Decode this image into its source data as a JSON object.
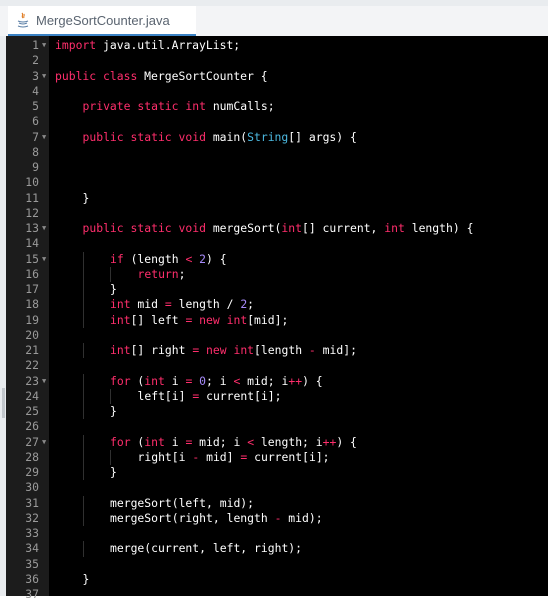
{
  "tab": {
    "filename": "MergeSortCounter.java",
    "icon": "java-file-icon"
  },
  "colors": {
    "keyword": "#ff2e6c",
    "type": "#4cb9e0",
    "number": "#a78bfa",
    "plain": "#ffffff",
    "line_number": "#9a9a9a",
    "editor_bg": "#000000",
    "tab_accent": "#3b82c4"
  },
  "lines": [
    {
      "n": "1",
      "fold": true,
      "indent": 0,
      "tokens": [
        [
          "kw",
          "import"
        ],
        [
          "p",
          " java.util.ArrayList;"
        ]
      ]
    },
    {
      "n": "2",
      "fold": false,
      "indent": 0,
      "tokens": []
    },
    {
      "n": "3",
      "fold": true,
      "indent": 0,
      "tokens": [
        [
          "kw",
          "public"
        ],
        [
          "p",
          " "
        ],
        [
          "kw",
          "class"
        ],
        [
          "p",
          " MergeSortCounter {"
        ]
      ]
    },
    {
      "n": "4",
      "fold": false,
      "indent": 0,
      "tokens": []
    },
    {
      "n": "5",
      "fold": false,
      "indent": 1,
      "tokens": [
        [
          "kw",
          "private"
        ],
        [
          "p",
          " "
        ],
        [
          "kw",
          "static"
        ],
        [
          "p",
          " "
        ],
        [
          "kw",
          "int"
        ],
        [
          "p",
          " numCalls;"
        ]
      ]
    },
    {
      "n": "6",
      "fold": false,
      "indent": 0,
      "tokens": []
    },
    {
      "n": "7",
      "fold": true,
      "indent": 1,
      "tokens": [
        [
          "kw",
          "public"
        ],
        [
          "p",
          " "
        ],
        [
          "kw",
          "static"
        ],
        [
          "p",
          " "
        ],
        [
          "kw",
          "void"
        ],
        [
          "p",
          " main("
        ],
        [
          "ty",
          "String"
        ],
        [
          "p",
          "[] args) {"
        ]
      ]
    },
    {
      "n": "8",
      "fold": false,
      "indent": 0,
      "tokens": []
    },
    {
      "n": "9",
      "fold": false,
      "indent": 0,
      "tokens": []
    },
    {
      "n": "10",
      "fold": false,
      "indent": 0,
      "tokens": []
    },
    {
      "n": "11",
      "fold": false,
      "indent": 1,
      "tokens": [
        [
          "p",
          "}"
        ]
      ]
    },
    {
      "n": "12",
      "fold": false,
      "indent": 0,
      "tokens": []
    },
    {
      "n": "13",
      "fold": true,
      "indent": 1,
      "tokens": [
        [
          "kw",
          "public"
        ],
        [
          "p",
          " "
        ],
        [
          "kw",
          "static"
        ],
        [
          "p",
          " "
        ],
        [
          "kw",
          "void"
        ],
        [
          "p",
          " mergeSort("
        ],
        [
          "kw",
          "int"
        ],
        [
          "p",
          "[] current, "
        ],
        [
          "kw",
          "int"
        ],
        [
          "p",
          " length) {"
        ]
      ]
    },
    {
      "n": "14",
      "fold": false,
      "indent": 0,
      "tokens": []
    },
    {
      "n": "15",
      "fold": true,
      "indent": 2,
      "tokens": [
        [
          "kw",
          "if"
        ],
        [
          "p",
          " (length "
        ],
        [
          "op",
          "<"
        ],
        [
          "p",
          " "
        ],
        [
          "nu",
          "2"
        ],
        [
          "p",
          ") {"
        ]
      ]
    },
    {
      "n": "16",
      "fold": false,
      "indent": 3,
      "tokens": [
        [
          "kw",
          "return"
        ],
        [
          "p",
          ";"
        ]
      ]
    },
    {
      "n": "17",
      "fold": false,
      "indent": 2,
      "tokens": [
        [
          "p",
          "}"
        ]
      ]
    },
    {
      "n": "18",
      "fold": false,
      "indent": 2,
      "tokens": [
        [
          "kw",
          "int"
        ],
        [
          "p",
          " mid "
        ],
        [
          "op",
          "="
        ],
        [
          "p",
          " length / "
        ],
        [
          "nu",
          "2"
        ],
        [
          "p",
          ";"
        ]
      ]
    },
    {
      "n": "19",
      "fold": false,
      "indent": 2,
      "tokens": [
        [
          "kw",
          "int"
        ],
        [
          "p",
          "[] left "
        ],
        [
          "op",
          "="
        ],
        [
          "p",
          " "
        ],
        [
          "kw",
          "new"
        ],
        [
          "p",
          " "
        ],
        [
          "kw",
          "int"
        ],
        [
          "p",
          "[mid];"
        ]
      ]
    },
    {
      "n": "20",
      "fold": false,
      "indent": 0,
      "tokens": []
    },
    {
      "n": "21",
      "fold": false,
      "indent": 2,
      "tokens": [
        [
          "kw",
          "int"
        ],
        [
          "p",
          "[] right "
        ],
        [
          "op",
          "="
        ],
        [
          "p",
          " "
        ],
        [
          "kw",
          "new"
        ],
        [
          "p",
          " "
        ],
        [
          "kw",
          "int"
        ],
        [
          "p",
          "[length "
        ],
        [
          "op",
          "-"
        ],
        [
          "p",
          " mid];"
        ]
      ]
    },
    {
      "n": "22",
      "fold": false,
      "indent": 0,
      "tokens": []
    },
    {
      "n": "23",
      "fold": true,
      "indent": 2,
      "tokens": [
        [
          "kw",
          "for"
        ],
        [
          "p",
          " ("
        ],
        [
          "kw",
          "int"
        ],
        [
          "p",
          " i "
        ],
        [
          "op",
          "="
        ],
        [
          "p",
          " "
        ],
        [
          "nu",
          "0"
        ],
        [
          "p",
          "; i "
        ],
        [
          "op",
          "<"
        ],
        [
          "p",
          " mid; i"
        ],
        [
          "op",
          "++"
        ],
        [
          "p",
          ") {"
        ]
      ]
    },
    {
      "n": "24",
      "fold": false,
      "indent": 3,
      "tokens": [
        [
          "p",
          "left[i] "
        ],
        [
          "op",
          "="
        ],
        [
          "p",
          " current[i];"
        ]
      ]
    },
    {
      "n": "25",
      "fold": false,
      "indent": 2,
      "tokens": [
        [
          "p",
          "}"
        ]
      ]
    },
    {
      "n": "26",
      "fold": false,
      "indent": 0,
      "tokens": []
    },
    {
      "n": "27",
      "fold": true,
      "indent": 2,
      "tokens": [
        [
          "kw",
          "for"
        ],
        [
          "p",
          " ("
        ],
        [
          "kw",
          "int"
        ],
        [
          "p",
          " i "
        ],
        [
          "op",
          "="
        ],
        [
          "p",
          " mid; i "
        ],
        [
          "op",
          "<"
        ],
        [
          "p",
          " length; i"
        ],
        [
          "op",
          "++"
        ],
        [
          "p",
          ") {"
        ]
      ]
    },
    {
      "n": "28",
      "fold": false,
      "indent": 3,
      "tokens": [
        [
          "p",
          "right[i "
        ],
        [
          "op",
          "-"
        ],
        [
          "p",
          " mid] "
        ],
        [
          "op",
          "="
        ],
        [
          "p",
          " current[i];"
        ]
      ]
    },
    {
      "n": "29",
      "fold": false,
      "indent": 2,
      "tokens": [
        [
          "p",
          "}"
        ]
      ]
    },
    {
      "n": "30",
      "fold": false,
      "indent": 0,
      "tokens": []
    },
    {
      "n": "31",
      "fold": false,
      "indent": 2,
      "tokens": [
        [
          "p",
          "mergeSort(left, mid);"
        ]
      ]
    },
    {
      "n": "32",
      "fold": false,
      "indent": 2,
      "tokens": [
        [
          "p",
          "mergeSort(right, length "
        ],
        [
          "op",
          "-"
        ],
        [
          "p",
          " mid);"
        ]
      ]
    },
    {
      "n": "33",
      "fold": false,
      "indent": 0,
      "tokens": []
    },
    {
      "n": "34",
      "fold": false,
      "indent": 2,
      "tokens": [
        [
          "p",
          "merge(current, left, right);"
        ]
      ]
    },
    {
      "n": "35",
      "fold": false,
      "indent": 0,
      "tokens": []
    },
    {
      "n": "36",
      "fold": false,
      "indent": 1,
      "tokens": [
        [
          "p",
          "}"
        ]
      ]
    },
    {
      "n": "37",
      "fold": false,
      "indent": 0,
      "tokens": []
    }
  ]
}
